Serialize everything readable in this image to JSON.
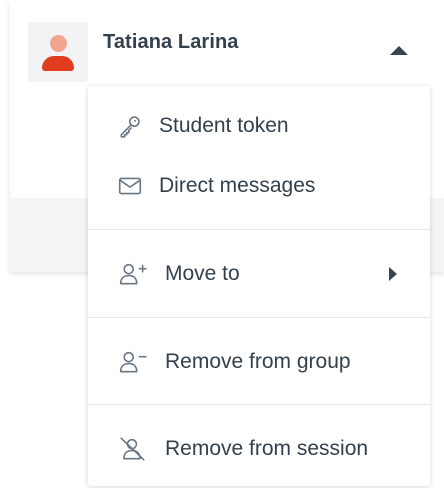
{
  "user": {
    "name": "Tatiana Larina"
  },
  "colors": {
    "avatar_head": "#f2a48f",
    "avatar_body": "#e03d1f",
    "text": "#34404c",
    "icon": "#6b7785"
  },
  "menu": {
    "items": [
      {
        "label": "Student token",
        "icon": "key-icon"
      },
      {
        "label": "Direct messages",
        "icon": "envelope-icon"
      },
      {
        "label": "Move to",
        "icon": "user-plus-icon",
        "submenu": true
      },
      {
        "label": "Remove from group",
        "icon": "user-minus-icon"
      },
      {
        "label": "Remove from session",
        "icon": "user-off-icon"
      }
    ]
  }
}
